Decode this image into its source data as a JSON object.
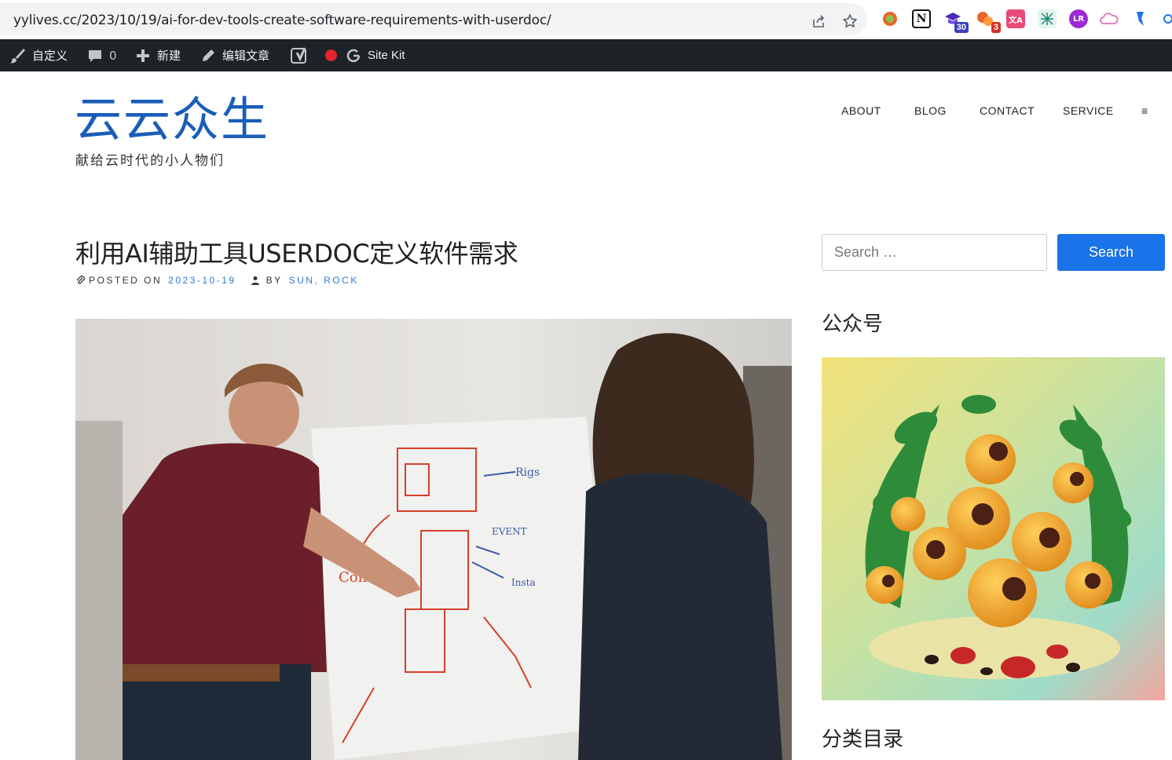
{
  "browser": {
    "url": "yylives.cc/2023/10/19/ai-for-dev-tools-create-software-requirements-with-userdoc/",
    "icons": [
      "share-icon",
      "star-icon"
    ],
    "extensions": [
      {
        "name": "circle-extension-icon",
        "color": "#e8672a"
      },
      {
        "name": "notion-icon",
        "color": "#111111",
        "glyph": "N"
      },
      {
        "name": "graduation-cap-extension-icon",
        "color": "#4a2bb8",
        "badge": "30",
        "badge_color": "#3a3fbf"
      },
      {
        "name": "bubbles-extension-icon",
        "color": "#f0642c",
        "badge": "3",
        "badge_color": "#d93025"
      },
      {
        "name": "translate-extension-icon",
        "color": "#e84a7a",
        "glyph": "文A"
      },
      {
        "name": "network-extension-icon",
        "color": "#1f8a70"
      },
      {
        "name": "lr-extension-icon",
        "color": "#9b2bd6",
        "glyph": "LR"
      },
      {
        "name": "cloud-extension-icon",
        "color": "#e46fb0"
      },
      {
        "name": "bookmark-extension-icon",
        "color": "#1a73e8"
      }
    ]
  },
  "adminbar": {
    "customize": "自定义",
    "comments_count": "0",
    "new_label": "新建",
    "edit_label": "编辑文章",
    "sitekit_label": "Site Kit",
    "status_color": "#e0262c"
  },
  "site": {
    "title": "云云众生",
    "description": "献给云时代的小人物们"
  },
  "nav": {
    "items": [
      "ABOUT",
      "BLOG",
      "CONTACT",
      "SERVICE"
    ],
    "menu_toggle": "≡"
  },
  "post": {
    "title": "利用AI辅助工具USERDOC定义软件需求",
    "posted_on_label": "POSTED ON",
    "date": "2023-10-19",
    "by_label": "BY",
    "author": "SUN, ROCK"
  },
  "sidebar": {
    "search_placeholder": "Search …",
    "search_button": "Search",
    "widget1_title": "公众号",
    "widget2_title": "分类目录"
  },
  "colors": {
    "accent": "#1a73e8",
    "site_title": "#1a5db8",
    "adminbar": "#1d2327",
    "link": "#2b7bd6"
  }
}
